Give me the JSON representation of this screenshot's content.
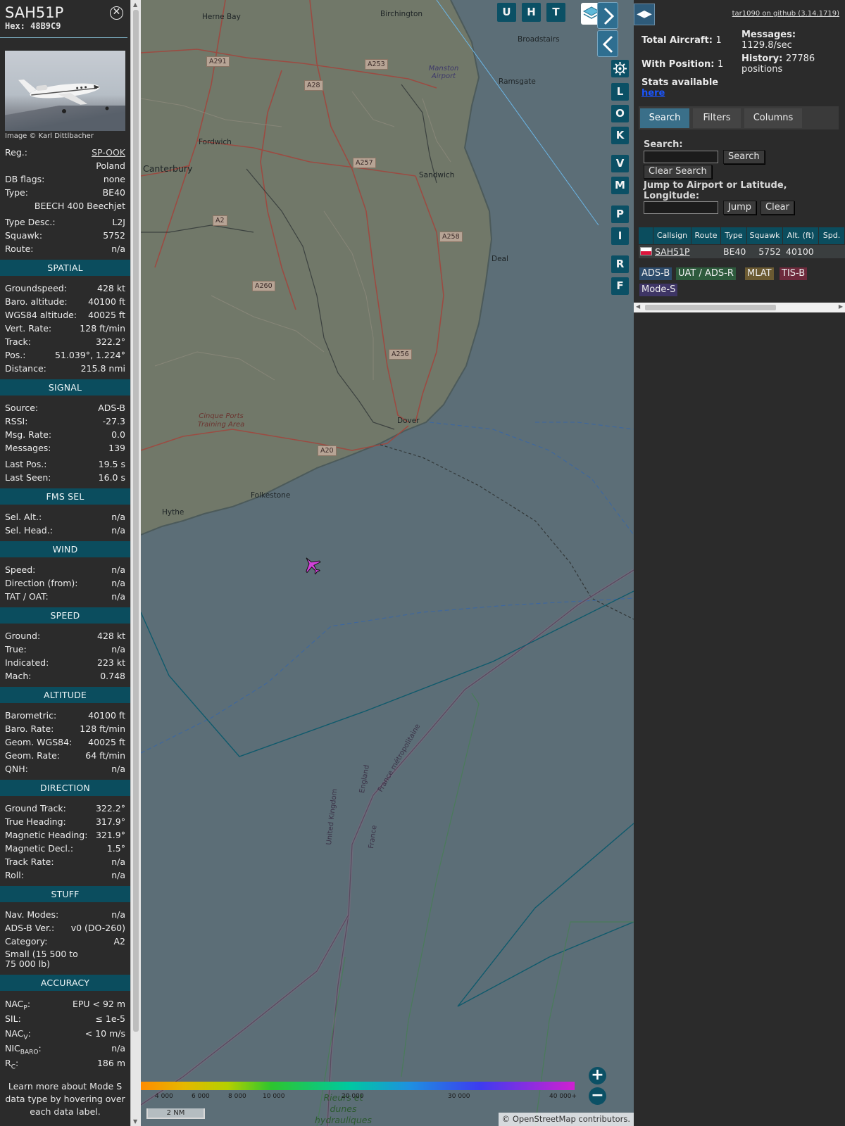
{
  "aircraft": {
    "callsign": "SAH51P",
    "hex": "Hex: 48B9C9",
    "photo_credit": "Image © Karl Dittlbacher",
    "reg_label": "Reg.:",
    "reg": "SP-OOK",
    "country": "Poland",
    "dbflags_label": "DB flags:",
    "dbflags": "none",
    "type_label": "Type:",
    "type": "BE40",
    "type_full": "BEECH 400 Beechjet",
    "typedesc_label": "Type Desc.:",
    "typedesc": "L2J",
    "squawk_label": "Squawk:",
    "squawk": "5752",
    "route_label": "Route:",
    "route": "n/a"
  },
  "sections": {
    "spatial": "SPATIAL",
    "signal": "SIGNAL",
    "fms": "FMS SEL",
    "wind": "WIND",
    "speed": "SPEED",
    "altitude": "ALTITUDE",
    "direction": "DIRECTION",
    "stuff": "STUFF",
    "accuracy": "ACCURACY"
  },
  "spatial": [
    {
      "label": "Groundspeed:",
      "value": "428 kt"
    },
    {
      "label": "Baro. altitude:",
      "value": "40100 ft"
    },
    {
      "label": "WGS84 altitude:",
      "value": "40025 ft"
    },
    {
      "label": "Vert. Rate:",
      "value": "128 ft/min"
    },
    {
      "label": "Track:",
      "value": "322.2°"
    },
    {
      "label": "Pos.:",
      "value": "51.039°, 1.224°"
    },
    {
      "label": "Distance:",
      "value": "215.8 nmi"
    }
  ],
  "signal": [
    {
      "label": "Source:",
      "value": "ADS-B"
    },
    {
      "label": "RSSI:",
      "value": "-27.3"
    },
    {
      "label": "Msg. Rate:",
      "value": "0.0"
    },
    {
      "label": "Messages:",
      "value": "139"
    },
    {
      "label": "Last Pos.:",
      "value": "19.5 s"
    },
    {
      "label": "Last Seen:",
      "value": "16.0 s"
    }
  ],
  "fms": [
    {
      "label": "Sel. Alt.:",
      "value": "n/a"
    },
    {
      "label": "Sel. Head.:",
      "value": "n/a"
    }
  ],
  "wind": [
    {
      "label": "Speed:",
      "value": "n/a"
    },
    {
      "label": "Direction (from):",
      "value": "n/a"
    },
    {
      "label": "TAT / OAT:",
      "value": "n/a"
    }
  ],
  "speed": [
    {
      "label": "Ground:",
      "value": "428 kt"
    },
    {
      "label": "True:",
      "value": "n/a"
    },
    {
      "label": "Indicated:",
      "value": "223 kt"
    },
    {
      "label": "Mach:",
      "value": "0.748"
    }
  ],
  "altitude": [
    {
      "label": "Barometric:",
      "value": "40100 ft"
    },
    {
      "label": "Baro. Rate:",
      "value": "128 ft/min"
    },
    {
      "label": "Geom. WGS84:",
      "value": "40025 ft"
    },
    {
      "label": "Geom. Rate:",
      "value": "64 ft/min"
    },
    {
      "label": "QNH:",
      "value": "n/a"
    }
  ],
  "direction": [
    {
      "label": "Ground Track:",
      "value": "322.2°"
    },
    {
      "label": "True Heading:",
      "value": "317.9°"
    },
    {
      "label": "Magnetic Heading:",
      "value": "321.9°"
    },
    {
      "label": "Magnetic Decl.:",
      "value": "1.5°"
    },
    {
      "label": "Track Rate:",
      "value": "n/a"
    },
    {
      "label": "Roll:",
      "value": "n/a"
    }
  ],
  "stuff": {
    "navmodes_label": "Nav. Modes:",
    "navmodes": "n/a",
    "adsbver_label": "ADS-B Ver.:",
    "adsbver": "v0 (DO-260)",
    "category_label": "Category:",
    "category": "A2",
    "category_desc": "Small (15 500 to 75 000 lb)"
  },
  "accuracy": {
    "nacp_label": "NAC",
    "nacp_sub": "P",
    "nacp": "EPU < 92 m",
    "sil_label": "SIL:",
    "sil": "≤ 1e-5",
    "nacv_label": "NAC",
    "nacv_sub": "V",
    "nacv": "< 10 m/s",
    "nicbaro_label": "NIC",
    "nicbaro_sub": "BARO",
    "nicbaro": "n/a",
    "rc_label": "R",
    "rc_sub": "C",
    "rc": "186 m"
  },
  "learn_more": "Learn more about Mode S data type by hovering over each data label.",
  "map": {
    "places": [
      "Herne Bay",
      "Birchington",
      "Broadstairs",
      "Manston Airport",
      "Ramsgate",
      "Fordwich",
      "Canterbury",
      "Sandwich",
      "Deal",
      "Dover",
      "Cinque Ports Training Area",
      "Folkestone",
      "Hythe",
      "United Kingdom",
      "England",
      "France",
      "France métropolitaine",
      "Rieurs et dunes hydrauliques"
    ],
    "roads": [
      "A291",
      "A253",
      "A28",
      "A257",
      "A2",
      "A258",
      "A260",
      "A256",
      "A20"
    ],
    "buttons": [
      "U",
      "H",
      "T",
      "L",
      "O",
      "K",
      "V",
      "M",
      "P",
      "I",
      "R",
      "F"
    ],
    "colorbar_labels": [
      "4 000",
      "6 000",
      "8 000",
      "10 000",
      "20 000",
      "30 000",
      "40 000+"
    ],
    "scale": "2 NM",
    "attribution": "© OpenStreetMap contributors."
  },
  "panel": {
    "github": "tar1090 on github (3.14.1719)",
    "total_label": "Total Aircraft:",
    "total": "1",
    "withpos_label": "With Position:",
    "withpos": "1",
    "stats_label": "Stats available",
    "stats_link": "here",
    "messages_label": "Messages:",
    "messages": "1129.8/sec",
    "history_label": "History:",
    "history": "27786 positions",
    "tabs": [
      "Search",
      "Filters",
      "Columns"
    ],
    "search_label": "Search:",
    "search_btn": "Search",
    "clear_search_btn": "Clear Search",
    "jump_label": "Jump to Airport or Latitude, Longitude:",
    "jump_btn": "Jump",
    "clear_btn": "Clear",
    "columns": [
      "Callsign",
      "Route",
      "Type",
      "Squawk",
      "Alt. (ft)",
      "Spd."
    ],
    "row": {
      "callsign": "SAH51P",
      "type": "BE40",
      "squawk": "5752",
      "alt": "40100"
    },
    "legend": [
      "ADS-B",
      "UAT / ADS-R",
      "MLAT",
      "TIS-B",
      "Mode-S"
    ]
  },
  "colors": {
    "section_bg": "#0b4d5e",
    "map_sea": "#5c6e77",
    "aircraft": "#d042d8",
    "legend_adsb": "#2c4b6b",
    "legend_uat": "#2d5a3c",
    "legend_mlat": "#6b5a32",
    "legend_tisb": "#6e2a3c",
    "legend_modes": "#3e3565"
  }
}
